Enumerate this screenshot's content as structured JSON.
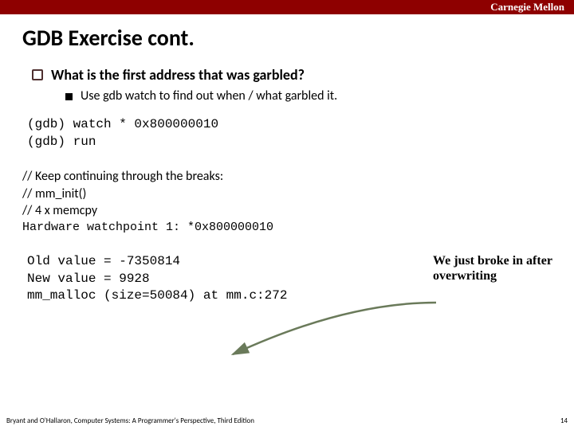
{
  "brand": "Carnegie Mellon",
  "title": "GDB Exercise cont.",
  "bullet1": "What is the first address that was garbled?",
  "bullet2": "Use gdb watch to find out when / what garbled it.",
  "code": {
    "line1": "(gdb) watch * 0x800000010",
    "line2": "(gdb) run"
  },
  "comments": {
    "c1": "// Keep continuing through the breaks:",
    "c2": "// mm_init()",
    "c3": "// 4 x memcpy",
    "mono": "Hardware watchpoint 1: *0x800000010"
  },
  "callout": "We just broke in after overwriting",
  "result": {
    "l1": "Old value = -7350814",
    "l2": "New value = 9928",
    "l3": "mm_malloc (size=50084) at mm.c:272"
  },
  "footer_left": "Bryant and O'Hallaron, Computer Systems: A Programmer's Perspective, Third Edition",
  "footer_right": "14"
}
